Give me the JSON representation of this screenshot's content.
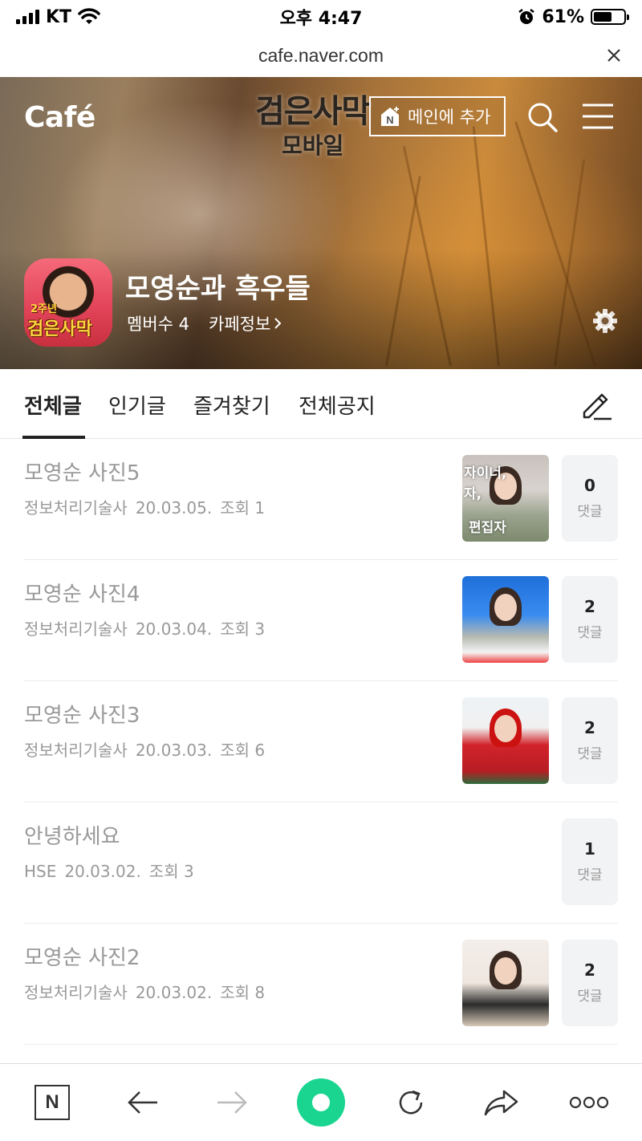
{
  "status_bar": {
    "carrier": "KT",
    "time": "오후 4:47",
    "battery_percent": "61%",
    "battery_level": 0.61
  },
  "browser": {
    "url": "cafe.naver.com"
  },
  "hero": {
    "cafe_logo": "Café",
    "game_logo_line1": "검은사막",
    "game_logo_line2": "모바일",
    "add_to_main_label": "메인에 추가",
    "avatar_badge_small": "2주년",
    "avatar_badge_text": "검은사막",
    "cafe_name": "모영순과 흑우들",
    "member_label": "멤버수 4",
    "cafe_info_label": "카페정보"
  },
  "tabs": [
    {
      "label": "전체글",
      "active": true
    },
    {
      "label": "인기글",
      "active": false
    },
    {
      "label": "즐겨찾기",
      "active": false
    },
    {
      "label": "전체공지",
      "active": false
    }
  ],
  "posts": [
    {
      "title": "모영순 사진5",
      "author": "정보처리기술사",
      "date": "20.03.05.",
      "views": "조회 1",
      "comment_count": "0",
      "comment_label": "댓글",
      "thumb_text_top": "자이너,",
      "thumb_text_mid": "자,",
      "thumb_text_bottom": "편집자"
    },
    {
      "title": "모영순 사진4",
      "author": "정보처리기술사",
      "date": "20.03.04.",
      "views": "조회 3",
      "comment_count": "2",
      "comment_label": "댓글"
    },
    {
      "title": "모영순 사진3",
      "author": "정보처리기술사",
      "date": "20.03.03.",
      "views": "조회 6",
      "comment_count": "2",
      "comment_label": "댓글"
    },
    {
      "title": "안녕하세요",
      "author": "HSE",
      "date": "20.03.02.",
      "views": "조회 3",
      "comment_count": "1",
      "comment_label": "댓글"
    },
    {
      "title": "모영순 사진2",
      "author": "정보처리기술사",
      "date": "20.03.02.",
      "views": "조회 8",
      "comment_count": "2",
      "comment_label": "댓글"
    }
  ],
  "bottom_bar": {
    "naver_letter": "N",
    "items": [
      "naver-home-icon",
      "back-arrow-icon",
      "forward-arrow-icon",
      "home-dot-icon",
      "refresh-icon",
      "share-icon",
      "more-icon"
    ],
    "accent_color": "#1ad590"
  }
}
